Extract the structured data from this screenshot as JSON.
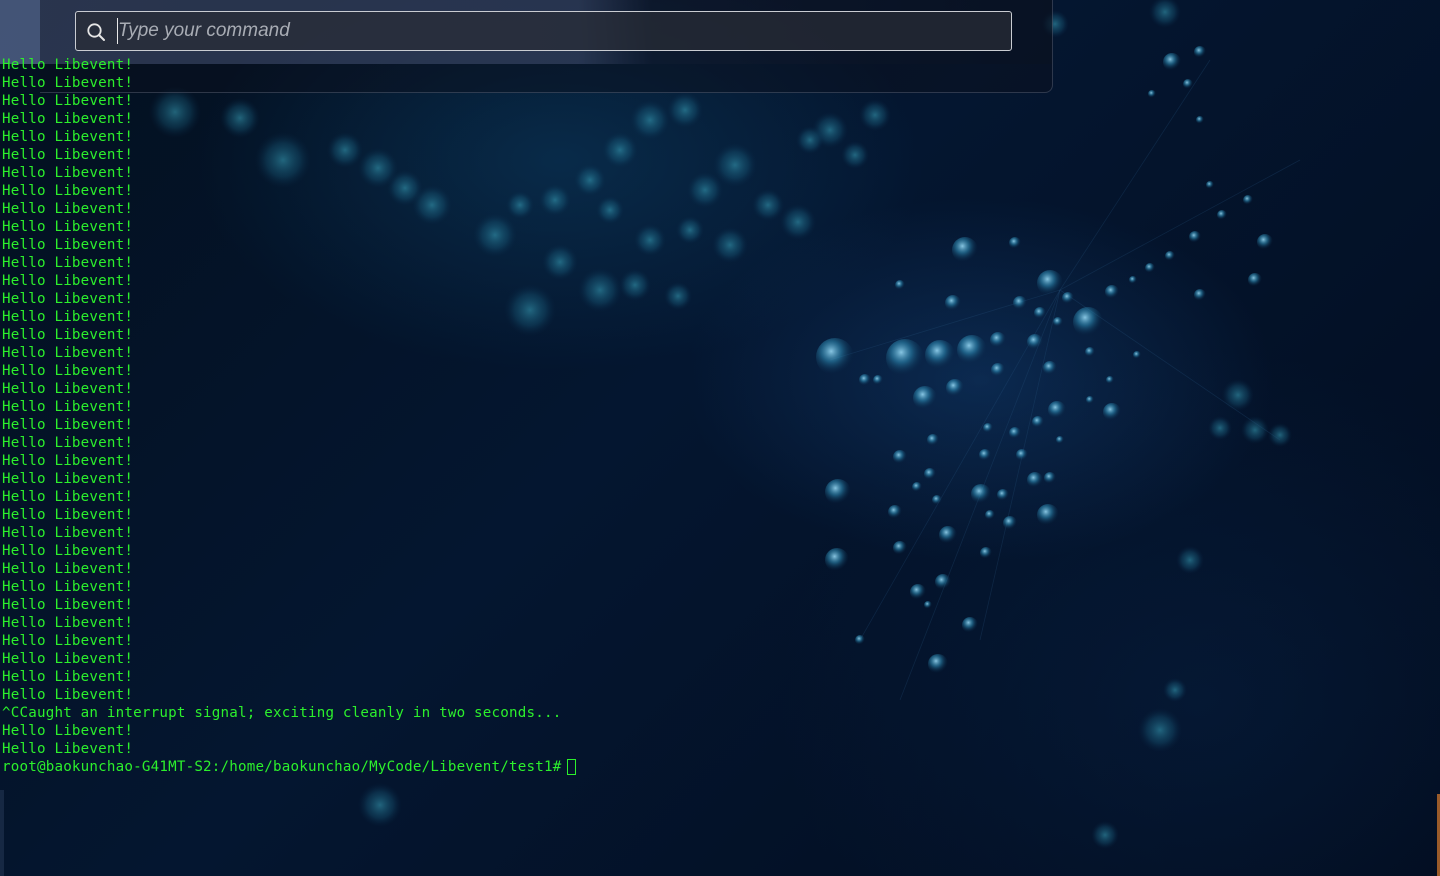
{
  "dash": {
    "search_placeholder": "Type your command",
    "search_value": ""
  },
  "terminal": {
    "lines": [
      "Hello Libevent!",
      "Hello Libevent!",
      "Hello Libevent!",
      "Hello Libevent!",
      "Hello Libevent!",
      "Hello Libevent!",
      "Hello Libevent!",
      "Hello Libevent!",
      "Hello Libevent!",
      "Hello Libevent!",
      "Hello Libevent!",
      "Hello Libevent!",
      "Hello Libevent!",
      "Hello Libevent!",
      "Hello Libevent!",
      "Hello Libevent!",
      "Hello Libevent!",
      "Hello Libevent!",
      "Hello Libevent!",
      "Hello Libevent!",
      "Hello Libevent!",
      "Hello Libevent!",
      "Hello Libevent!",
      "Hello Libevent!",
      "Hello Libevent!",
      "Hello Libevent!",
      "Hello Libevent!",
      "Hello Libevent!",
      "Hello Libevent!",
      "Hello Libevent!",
      "Hello Libevent!",
      "Hello Libevent!",
      "Hello Libevent!",
      "Hello Libevent!",
      "Hello Libevent!",
      "Hello Libevent!",
      "^CCaught an interrupt signal; exciting cleanly in two seconds...",
      "Hello Libevent!",
      "Hello Libevent!"
    ],
    "prompt": "root@baokunchao-G41MT-S2:/home/baokunchao/MyCode/Libevent/test1#"
  },
  "colors": {
    "terminal_text": "#2cf02c",
    "background": "#041630"
  }
}
